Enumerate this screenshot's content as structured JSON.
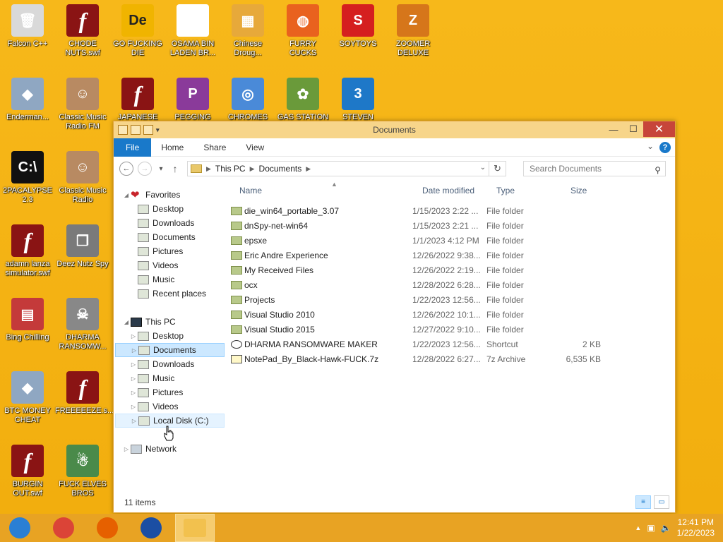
{
  "desktop_icons": [
    {
      "label": "Falcon C++",
      "icon": "recycle-bin-icon",
      "col": 0,
      "row": 0
    },
    {
      "label": "CHODE NUTS.swf",
      "icon": "flash-icon",
      "col": 1,
      "row": 0
    },
    {
      "label": "GO FUCKING DIE",
      "icon": "de-icon",
      "col": 2,
      "row": 0
    },
    {
      "label": "OSAMA BIN LADEN BR...",
      "icon": "obama-logo-icon",
      "col": 3,
      "row": 0
    },
    {
      "label": "Chinese Droug...",
      "icon": "mahjong-icon",
      "col": 4,
      "row": 0
    },
    {
      "label": "FURRY CUCKS",
      "icon": "firefox-icon",
      "col": 5,
      "row": 0
    },
    {
      "label": "SOYTOYS",
      "icon": "s-logo-icon",
      "col": 6,
      "row": 0
    },
    {
      "label": "ZOOMER DELUXE",
      "icon": "z-logo-icon",
      "col": 7,
      "row": 0
    },
    {
      "label": "Enderman...",
      "icon": "installer-icon",
      "col": 0,
      "row": 1
    },
    {
      "label": "Classic Music Radio FM",
      "icon": "portrait-icon",
      "col": 1,
      "row": 1
    },
    {
      "label": "JAPANESE",
      "icon": "flash-icon",
      "col": 2,
      "row": 1
    },
    {
      "label": "PEGGING",
      "icon": "p-logo-icon",
      "col": 3,
      "row": 1
    },
    {
      "label": "CHROMES",
      "icon": "chrome-icon",
      "col": 4,
      "row": 1
    },
    {
      "label": "GAS STATION",
      "icon": "plant-icon",
      "col": 5,
      "row": 1
    },
    {
      "label": "STEVEN",
      "icon": "three-logo-icon",
      "col": 6,
      "row": 1
    },
    {
      "label": "2PACALYPSE 2.3",
      "icon": "console-icon",
      "col": 0,
      "row": 2
    },
    {
      "label": "Classic Music Radio",
      "icon": "portrait-icon",
      "col": 1,
      "row": 2
    },
    {
      "label": "adamn lanza simulator.swf",
      "icon": "flash-icon",
      "col": 0,
      "row": 3
    },
    {
      "label": "Deez Nutz Spy",
      "icon": "windows-stack-icon",
      "col": 1,
      "row": 3
    },
    {
      "label": "Bing Chilling",
      "icon": "game-box-icon",
      "col": 0,
      "row": 4
    },
    {
      "label": "DHARMA RANSOMW...",
      "icon": "skull-icon",
      "col": 1,
      "row": 4
    },
    {
      "label": "BTC MONEY CHEAT",
      "icon": "installer-icon",
      "col": 0,
      "row": 5
    },
    {
      "label": "FREEEEEZE.s...",
      "icon": "flash-icon",
      "col": 1,
      "row": 5
    },
    {
      "label": "BURGIN OUT.swf",
      "icon": "flash-icon",
      "col": 0,
      "row": 6
    },
    {
      "label": "FUCK ELVES BROS",
      "icon": "santa-icon",
      "col": 1,
      "row": 6
    }
  ],
  "window": {
    "title": "Documents",
    "ribbon_tabs": [
      "File",
      "Home",
      "Share",
      "View"
    ],
    "address": {
      "segments": [
        "This PC",
        "Documents"
      ]
    },
    "search_placeholder": "Search Documents",
    "columns": {
      "name": "Name",
      "date": "Date modified",
      "type": "Type",
      "size": "Size"
    },
    "nav": [
      {
        "label": "Favorites",
        "level": 0,
        "icon": "heart-icon",
        "expander": "open"
      },
      {
        "label": "Desktop",
        "level": 1,
        "icon": "desktop-icon"
      },
      {
        "label": "Downloads",
        "level": 1,
        "icon": "downloads-icon"
      },
      {
        "label": "Documents",
        "level": 1,
        "icon": "documents-icon"
      },
      {
        "label": "Pictures",
        "level": 1,
        "icon": "pictures-icon"
      },
      {
        "label": "Videos",
        "level": 1,
        "icon": "videos-icon"
      },
      {
        "label": "Music",
        "level": 1,
        "icon": "music-icon"
      },
      {
        "label": "Recent places",
        "level": 1,
        "icon": "recent-icon"
      },
      {
        "label": "",
        "level": 0,
        "spacer": true
      },
      {
        "label": "This PC",
        "level": 0,
        "icon": "pc-icon",
        "expander": "open"
      },
      {
        "label": "Desktop",
        "level": 1,
        "icon": "desktop-icon",
        "expander": "closed"
      },
      {
        "label": "Documents",
        "level": 1,
        "icon": "documents-icon",
        "expander": "closed",
        "selected": true
      },
      {
        "label": "Downloads",
        "level": 1,
        "icon": "downloads-icon",
        "expander": "closed"
      },
      {
        "label": "Music",
        "level": 1,
        "icon": "music-icon",
        "expander": "closed"
      },
      {
        "label": "Pictures",
        "level": 1,
        "icon": "pictures-icon",
        "expander": "closed"
      },
      {
        "label": "Videos",
        "level": 1,
        "icon": "videos-icon",
        "expander": "closed"
      },
      {
        "label": "Local Disk (C:)",
        "level": 1,
        "icon": "disk-icon",
        "expander": "closed",
        "hover": true
      },
      {
        "label": "",
        "level": 0,
        "spacer": true
      },
      {
        "label": "Network",
        "level": 0,
        "icon": "network-icon",
        "expander": "closed"
      }
    ],
    "files": [
      {
        "name": "die_win64_portable_3.07",
        "date": "1/15/2023 2:22 ...",
        "type": "File folder",
        "size": "",
        "icon": "folder-icon"
      },
      {
        "name": "dnSpy-net-win64",
        "date": "1/15/2023 2:21 ...",
        "type": "File folder",
        "size": "",
        "icon": "folder-icon"
      },
      {
        "name": "epsxe",
        "date": "1/1/2023 4:12 PM",
        "type": "File folder",
        "size": "",
        "icon": "folder-icon"
      },
      {
        "name": "Eric Andre Experience",
        "date": "12/26/2022 9:38...",
        "type": "File folder",
        "size": "",
        "icon": "folder-icon"
      },
      {
        "name": "My Received Files",
        "date": "12/26/2022 2:19...",
        "type": "File folder",
        "size": "",
        "icon": "folder-icon"
      },
      {
        "name": "ocx",
        "date": "12/28/2022 6:28...",
        "type": "File folder",
        "size": "",
        "icon": "folder-icon"
      },
      {
        "name": "Projects",
        "date": "1/22/2023 12:56...",
        "type": "File folder",
        "size": "",
        "icon": "folder-icon"
      },
      {
        "name": "Visual Studio 2010",
        "date": "12/26/2022 10:1...",
        "type": "File folder",
        "size": "",
        "icon": "folder-icon"
      },
      {
        "name": "Visual Studio 2015",
        "date": "12/27/2022 9:10...",
        "type": "File folder",
        "size": "",
        "icon": "folder-icon"
      },
      {
        "name": "DHARMA RANSOMWARE MAKER",
        "date": "1/22/2023 12:56...",
        "type": "Shortcut",
        "size": "2 KB",
        "icon": "shortcut-icon"
      },
      {
        "name": "NotePad_By_Black-Hawk-FUCK.7z",
        "date": "12/28/2022 6:27...",
        "type": "7z Archive",
        "size": "6,535 KB",
        "icon": "archive-icon"
      }
    ],
    "status": "11 items"
  },
  "taskbar": {
    "apps": [
      {
        "icon": "start-orb-icon",
        "color": "#2a7fd4"
      },
      {
        "icon": "chrome-icon",
        "color": "#db4437"
      },
      {
        "icon": "firefox-icon",
        "color": "#e66000"
      },
      {
        "icon": "obama-logo-icon",
        "color": "#1b4ea3"
      },
      {
        "icon": "explorer-icon",
        "color": "#f2c14e",
        "active": true
      }
    ],
    "time": "12:41 PM",
    "date": "1/22/2023"
  },
  "colors": {
    "accent": "#1979CA",
    "desktop": "#F5B414",
    "taskbar": "#E8A323",
    "close": "#C7453A"
  }
}
